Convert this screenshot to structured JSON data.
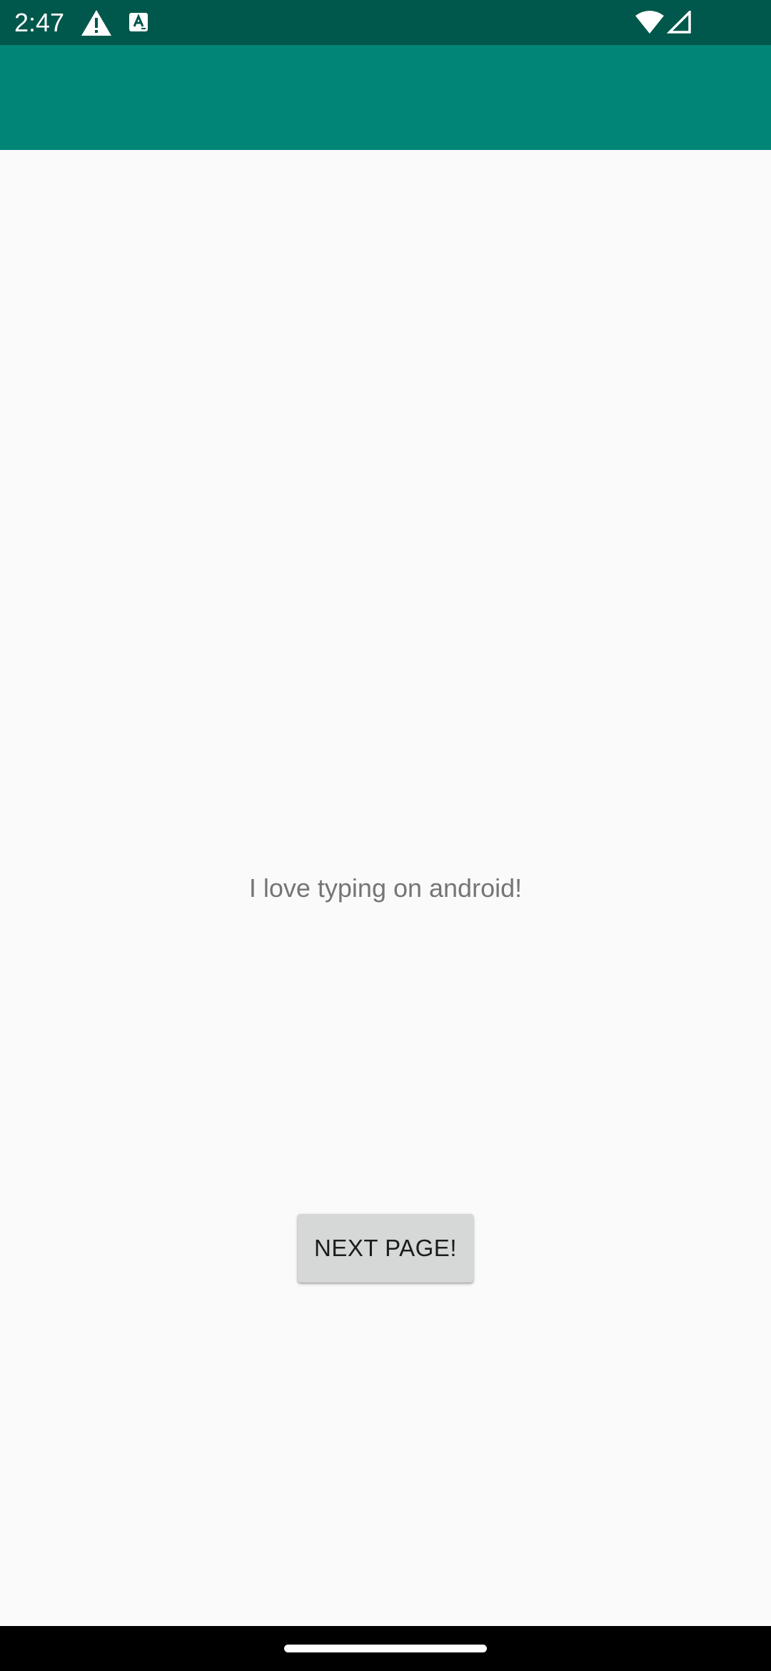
{
  "status_bar": {
    "time": "2:47",
    "background_color": "#00574b",
    "icons": [
      "alert-triangle-icon",
      "keyboard-a-icon",
      "wifi-icon",
      "cell-signal-icon"
    ]
  },
  "app_bar": {
    "background_color": "#008577"
  },
  "main": {
    "message": "I love typing on android!",
    "button_label": "NEXT PAGE!"
  },
  "nav_bar": {
    "handle": "gesture-handle"
  }
}
